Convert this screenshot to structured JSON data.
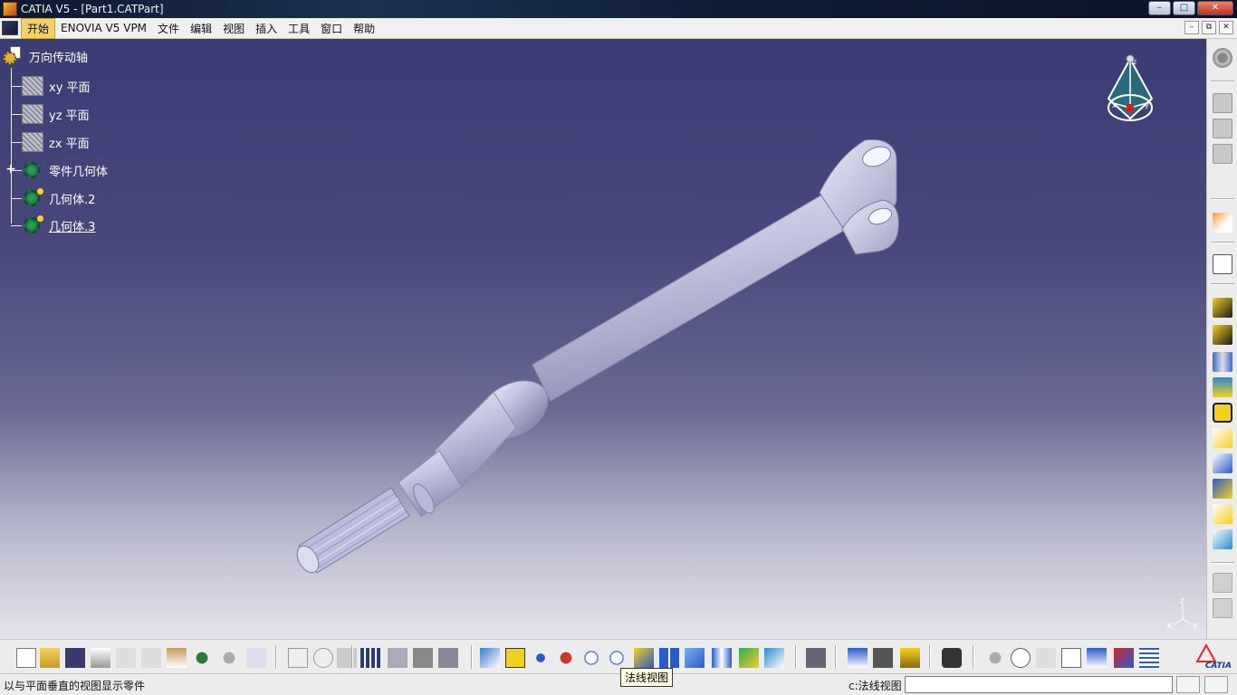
{
  "window": {
    "title": "CATIA V5 - [Part1.CATPart]",
    "buttons": [
      "–",
      "□",
      "✕"
    ]
  },
  "menubar": {
    "items": [
      "开始",
      "ENOVIA V5 VPM",
      "文件",
      "编辑",
      "视图",
      "插入",
      "工具",
      "窗口",
      "帮助"
    ],
    "active_index": 0,
    "mdi_buttons": [
      "–",
      "⧉",
      "✕"
    ]
  },
  "tree": {
    "root": "万向传动轴",
    "nodes": [
      {
        "label": "xy 平面",
        "icon": "plane-icon"
      },
      {
        "label": "yz 平面",
        "icon": "plane-icon"
      },
      {
        "label": "zx 平面",
        "icon": "plane-icon"
      },
      {
        "label": "零件几何体",
        "icon": "part-body-icon",
        "expandable": true
      },
      {
        "label": "几何体.2",
        "icon": "body-icon"
      },
      {
        "label": "几何体.3",
        "icon": "body-icon",
        "current": true
      }
    ]
  },
  "compass": {
    "labels": [
      "x",
      "y",
      "z"
    ]
  },
  "axis": {
    "labels": [
      "z",
      "x",
      "y"
    ]
  },
  "bottom_toolbar": {
    "icons": [
      "new-icon",
      "open-icon",
      "save-icon",
      "print-icon",
      "cut-icon",
      "copy-icon",
      "paste-icon",
      "undo-icon",
      "redo-icon",
      "whats-this-icon",
      "formula-icon",
      "comment-icon",
      "knowledge-icon",
      "table-icon",
      "tree-expand-icon",
      "lock-icon",
      "parameters-icon",
      "fly-mode-icon",
      "fit-all-icon",
      "pan-icon",
      "rotate-icon",
      "zoom-in-icon",
      "zoom-out-icon",
      "normal-view-icon",
      "multi-view-icon",
      "isometric-view-icon",
      "shading-icon",
      "hide-show-icon",
      "swap-visible-icon",
      "measure-between-icon",
      "measure-item-icon",
      "mass-icon",
      "capture-icon",
      "update-icon",
      "manipulate-icon",
      "compass-icon",
      "scale-icon",
      "catalog-icon",
      "analysis-icon",
      "multi-layer-icon"
    ],
    "tooltip": "法线视图"
  },
  "right_toolbar": {
    "icons": [
      "gear-icon",
      "body-1-icon",
      "body-2-icon",
      "body-3-icon",
      "select-icon",
      "sketch-icon",
      "pad-icon",
      "pocket-icon",
      "shaft-icon",
      "hole-icon",
      "rib-icon",
      "fillet-icon",
      "chamfer-icon",
      "draft-icon",
      "shell-icon",
      "thickness-icon",
      "surface-icon",
      "boolean-icon"
    ]
  },
  "statusbar": {
    "text": "以与平面垂直的视图显示零件",
    "command_label": "c:法线视图",
    "command_value": ""
  },
  "logo": {
    "text": "CATIA"
  },
  "colors": {
    "viewport_top": "#3c3c75",
    "viewport_bottom": "#e4e4ec",
    "part": "#c8c8e4",
    "menu_active": "#f3d16a"
  }
}
